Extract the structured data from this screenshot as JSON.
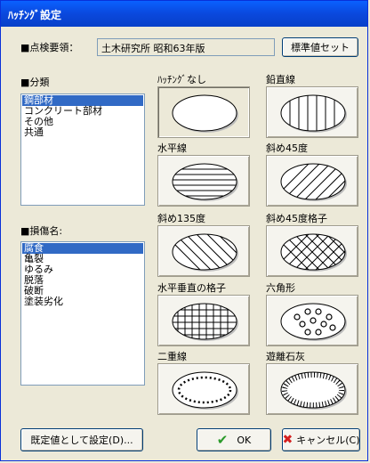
{
  "window": {
    "title": "ﾊｯﾁﾝｸﾞ設定"
  },
  "inspection": {
    "label": "■点検要領：",
    "value": "土木研究所 昭和63年版",
    "std_button": "標準値セット"
  },
  "category": {
    "label": "■分類",
    "items": [
      "鋼部材",
      "コンクリート部材",
      "その他",
      "共通"
    ],
    "selected": 0
  },
  "damage": {
    "label": "■損傷名:",
    "items": [
      "腐食",
      "亀裂",
      "ゆるみ",
      "脱落",
      "破断",
      "塗装劣化"
    ],
    "selected": 0
  },
  "patterns": [
    {
      "label": "ﾊｯﾁﾝｸﾞなし",
      "icon": "none-pattern-icon",
      "pressed": true
    },
    {
      "label": "鉛直線",
      "icon": "vertical-lines-icon"
    },
    {
      "label": "水平線",
      "icon": "horizontal-lines-icon"
    },
    {
      "label": "斜め45度",
      "icon": "diagonal-45-icon"
    },
    {
      "label": "斜め135度",
      "icon": "diagonal-135-icon"
    },
    {
      "label": "斜め45度格子",
      "icon": "diagonal-grid-icon"
    },
    {
      "label": "水平垂直の格子",
      "icon": "square-grid-icon"
    },
    {
      "label": "六角形",
      "icon": "hexagon-dots-icon"
    },
    {
      "label": "二重線",
      "icon": "double-line-icon"
    },
    {
      "label": "遊離石灰",
      "icon": "efflorescence-icon"
    }
  ],
  "buttons": {
    "default": "既定値として設定(D)...",
    "ok": "OK",
    "cancel": "キャンセル(C)"
  },
  "colors": {
    "title_bar": "#0a48dd",
    "selection": "#316ac5",
    "ok_check": "#2a9a2a",
    "cancel_x": "#d42020"
  }
}
